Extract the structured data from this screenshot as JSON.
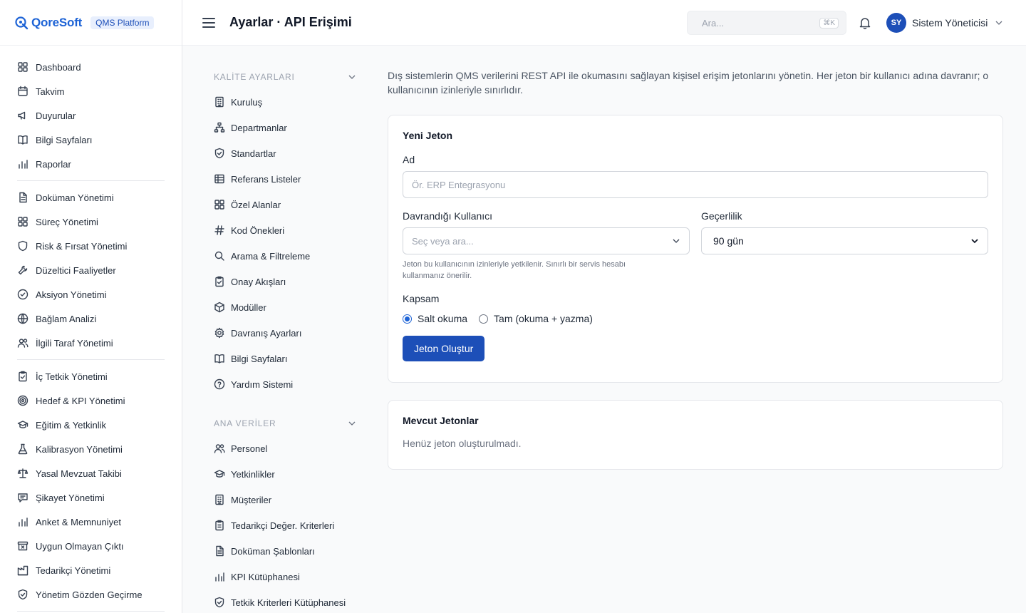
{
  "brand": {
    "name": "QoreSoft",
    "badge": "QMS Platform",
    "color": "#1d63d6"
  },
  "header": {
    "title": "Ayarlar · API Erişimi",
    "search_placeholder": "Ara...",
    "search_shortcut": "⌘K",
    "user_initials": "SY",
    "user_name": "Sistem Yöneticisi"
  },
  "sidebar": {
    "groups": [
      [
        {
          "label": "Dashboard",
          "icon": "grid-icon"
        },
        {
          "label": "Takvim",
          "icon": "calendar-icon"
        },
        {
          "label": "Duyurular",
          "icon": "megaphone-icon"
        },
        {
          "label": "Bilgi Sayfaları",
          "icon": "book-icon"
        },
        {
          "label": "Raporlar",
          "icon": "bar-chart-icon"
        }
      ],
      [
        {
          "label": "Doküman Yönetimi",
          "icon": "document-icon"
        },
        {
          "label": "Süreç Yönetimi",
          "icon": "grid-icon"
        },
        {
          "label": "Risk & Fırsat Yönetimi",
          "icon": "shield-icon"
        },
        {
          "label": "Düzeltici Faaliyetler",
          "icon": "wrench-icon"
        },
        {
          "label": "Aksiyon Yönetimi",
          "icon": "check-circle-icon"
        },
        {
          "label": "Bağlam Analizi",
          "icon": "globe-icon"
        },
        {
          "label": "İlgili Taraf Yönetimi",
          "icon": "users-icon"
        }
      ],
      [
        {
          "label": "İç Tetkik Yönetimi",
          "icon": "clipboard-check-icon"
        },
        {
          "label": "Hedef & KPI Yönetimi",
          "icon": "target-icon"
        },
        {
          "label": "Eğitim & Yetkinlik",
          "icon": "graduation-cap-icon"
        },
        {
          "label": "Kalibrasyon Yönetimi",
          "icon": "flask-icon"
        },
        {
          "label": "Yasal Mevzuat Takibi",
          "icon": "scale-icon"
        },
        {
          "label": "Şikayet Yönetimi",
          "icon": "message-icon"
        },
        {
          "label": "Anket & Memnuniyet",
          "icon": "bar-chart-icon"
        },
        {
          "label": "Uygun Olmayan Çıktı",
          "icon": "archive-x-icon"
        },
        {
          "label": "Tedarikçi Yönetimi",
          "icon": "factory-icon"
        },
        {
          "label": "Yönetim Gözden Geçirme",
          "icon": "shield-check-icon"
        }
      ]
    ]
  },
  "settings_nav": {
    "sections": [
      {
        "title": "KALİTE AYARLARI",
        "items": [
          {
            "label": "Kuruluş",
            "icon": "building-icon"
          },
          {
            "label": "Departmanlar",
            "icon": "sitemap-icon"
          },
          {
            "label": "Standartlar",
            "icon": "shield-check-icon"
          },
          {
            "label": "Referans Listeler",
            "icon": "table-icon"
          },
          {
            "label": "Özel Alanlar",
            "icon": "grid-icon"
          },
          {
            "label": "Kod Önekleri",
            "icon": "hash-icon"
          },
          {
            "label": "Arama & Filtreleme",
            "icon": "search-icon"
          },
          {
            "label": "Onay Akışları",
            "icon": "clipboard-check-icon"
          },
          {
            "label": "Modüller",
            "icon": "package-icon"
          },
          {
            "label": "Davranış Ayarları",
            "icon": "gear-icon"
          },
          {
            "label": "Bilgi Sayfaları",
            "icon": "book-icon"
          },
          {
            "label": "Yardım Sistemi",
            "icon": "help-circle-icon"
          }
        ]
      },
      {
        "title": "ANA VERİLER",
        "items": [
          {
            "label": "Personel",
            "icon": "users-icon"
          },
          {
            "label": "Yetkinlikler",
            "icon": "graduation-cap-icon"
          },
          {
            "label": "Müşteriler",
            "icon": "building-icon"
          },
          {
            "label": "Tedarikçi Değer. Kriterleri",
            "icon": "clipboard-icon"
          },
          {
            "label": "Doküman Şablonları",
            "icon": "document-icon"
          },
          {
            "label": "KPI Kütüphanesi",
            "icon": "bar-chart-icon"
          },
          {
            "label": "Tetkik Kriterleri Kütüphanesi",
            "icon": "shield-check-icon"
          }
        ]
      }
    ]
  },
  "main": {
    "intro": "Dış sistemlerin QMS verilerini REST API ile okumasını sağlayan kişisel erişim jetonlarını yönetin. Her jeton bir kullanıcı adına davranır; o kullanıcının izinleriyle sınırlıdır.",
    "new_token": {
      "title": "Yeni Jeton",
      "name_label": "Ad",
      "name_placeholder": "Ör. ERP Entegrasyonu",
      "user_label": "Davrandığı Kullanıcı",
      "user_placeholder": "Seç veya ara...",
      "user_help": "Jeton bu kullanıcının izinleriyle yetkilenir. Sınırlı bir servis hesabı kullanmanız önerilir.",
      "validity_label": "Geçerlilik",
      "validity_value": "90 gün",
      "scope_label": "Kapsam",
      "scope_options": [
        "Salt okuma",
        "Tam (okuma + yazma)"
      ],
      "scope_selected": "Salt okuma",
      "submit_label": "Jeton Oluştur"
    },
    "existing_tokens": {
      "title": "Mevcut Jetonlar",
      "empty": "Henüz jeton oluşturulmadı."
    }
  }
}
